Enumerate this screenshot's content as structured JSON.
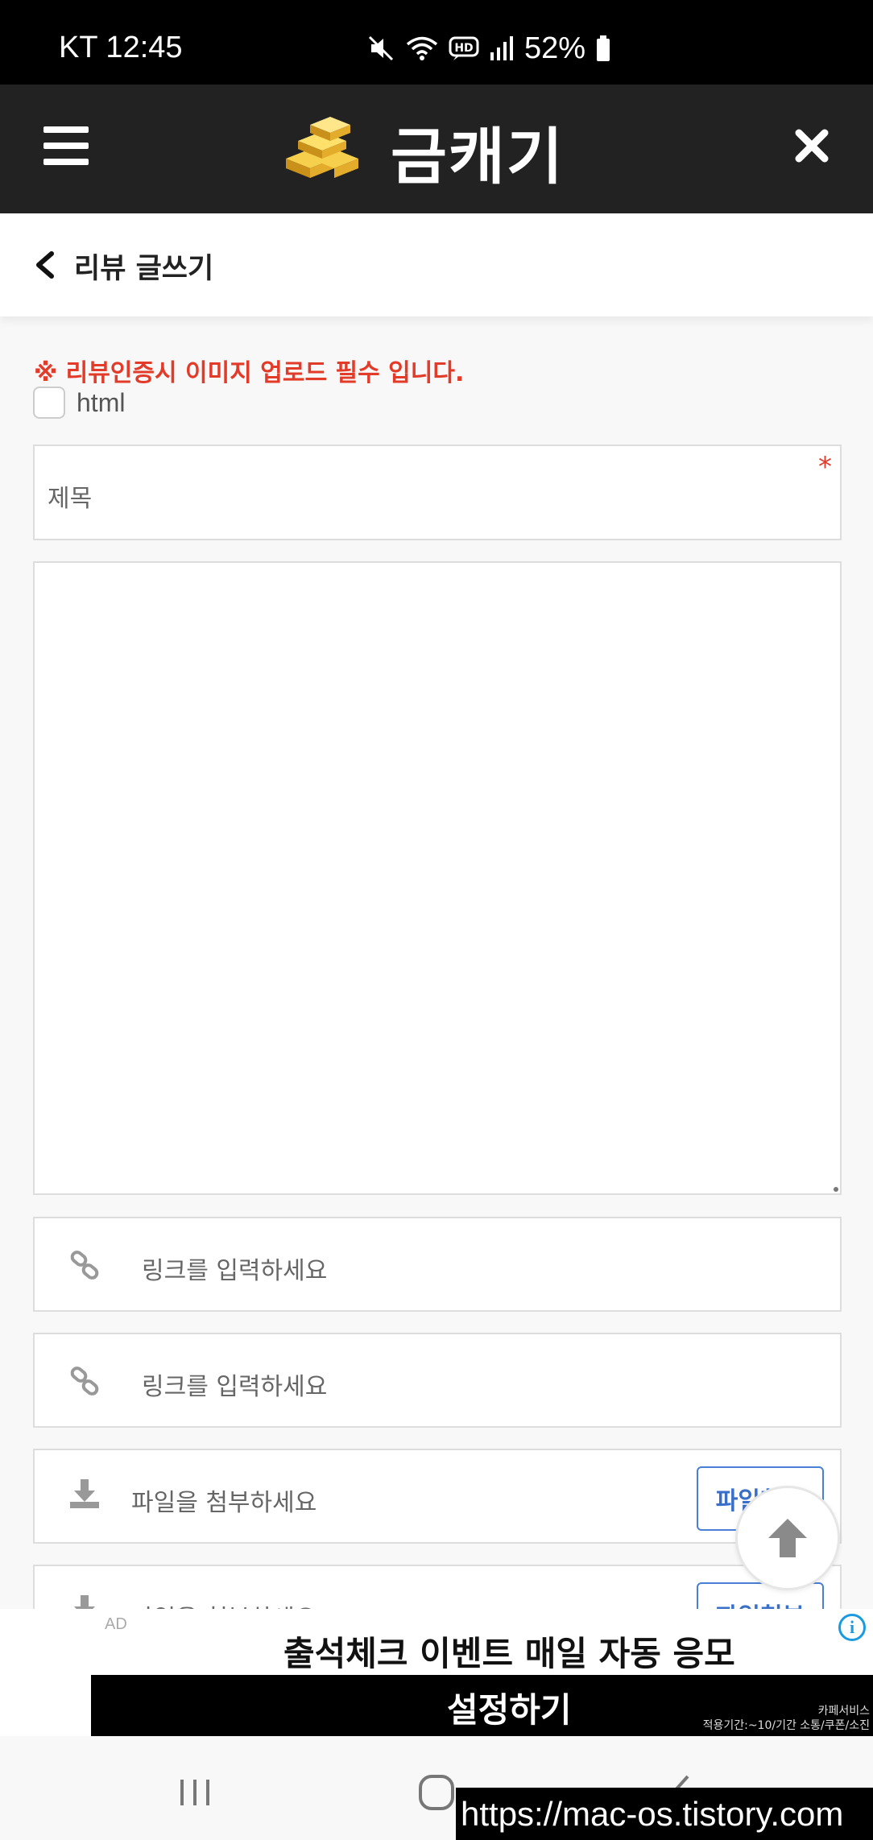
{
  "status_bar": {
    "carrier_time": "KT 12:45",
    "battery": "52%",
    "icons": [
      "mute-icon",
      "wifi-icon",
      "hd-icon",
      "signal-icon",
      "battery-icon"
    ]
  },
  "header": {
    "brand": "금캐기",
    "icons": [
      "menu-icon",
      "gold-bars-logo",
      "close-icon"
    ]
  },
  "subheader": {
    "title": "리뷰 글쓰기"
  },
  "form": {
    "notice": "※ 리뷰인증시 이미지 업로드 필수 입니다.",
    "html_checkbox_label": "html",
    "title_placeholder": "제목",
    "required_mark": "*",
    "link_placeholders": [
      "링크를 입력하세요",
      "링크를 입력하세요"
    ],
    "file_placeholders": [
      "파일을 첨부하세요",
      "파일을 첨부하세요"
    ],
    "file_button_labels": [
      "파일첨부",
      "파일첨부"
    ]
  },
  "ad": {
    "tag": "AD",
    "info": "i",
    "headline": "출석체크 이벤트 매일 자동 응모",
    "cta": "설정하기",
    "fine_print_1": "카페서비스",
    "fine_print_2": "적용기간:~10/기간 소통/쿠폰/소진"
  },
  "watermark": "https://mac-os.tistory.com",
  "colors": {
    "header_bg": "#222222",
    "notice_red": "#e23b2a",
    "button_blue": "#3a6fc8"
  }
}
